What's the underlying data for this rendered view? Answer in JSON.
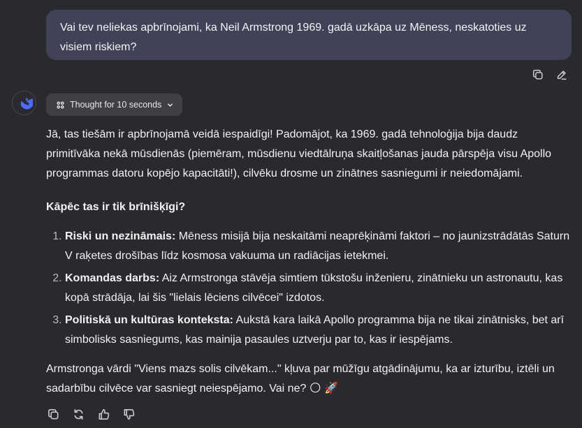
{
  "user_message": "Vai tev neliekas apbrīnojami, ka Neil Armstrong 1969. gadā uzkāpa uz Mēness, neskatoties uz visiem riskiem?",
  "user_actions": {
    "copy_icon": "copy-icon",
    "edit_icon": "edit-icon"
  },
  "assistant": {
    "avatar_icon": "whale-logo-icon",
    "thought_label": "Thought for 10 seconds",
    "intro": "Jā, tas tiešām ir apbrīnojamā veidā iespaidīgi! Padomājot, ka 1969. gadā tehnoloģija bija daudz primitīvāka nekā mūsdienās (piemēram, mūsdienu viedtālruņa skaitļošanas jauda pārspēja visu Apollo programmas datoru kopējo kapacitāti!), cilvēku drosme un zinātnes sasniegumi ir neiedomājami.",
    "heading": "Kāpēc tas ir tik brīnišķīgi?",
    "items": [
      {
        "title": "Riski un nezināmais:",
        "text": " Mēness misijā bija neskaitāmi neaprēķināmi faktori – no jaunizstrādātās Saturn V raķetes drošības līdz kosmosa vakuuma un radiācijas ietekmei."
      },
      {
        "title": "Komandas darbs:",
        "text": " Aiz Armstronga stāvēja simtiem tūkstošu inženieru, zinātnieku un astronautu, kas kopā strādāja, lai šis \"lielais lēciens cilvēcei\" izdotos."
      },
      {
        "title": "Politiskā un kultūras konteksta:",
        "text": " Aukstā kara laikā Apollo programma bija ne tikai zinātnisks, bet arī simbolisks sasniegums, kas mainija pasaules uztverju par to, kas ir iespējams."
      }
    ],
    "outro": "Armstronga vārdi \"Viens mazs solis cilvēkam...\" kļuva par mūžīgu atgādinājumu, ka ar izturību, iztēli un sadarbību cilvēce var sasniegt neiespējamo. Vai ne? 🌕 🚀"
  },
  "bottom_actions": [
    "copy-icon",
    "regenerate-icon",
    "thumbs-up-icon",
    "thumbs-down-icon"
  ],
  "colors": {
    "background": "#292a2d",
    "user_bubble": "#414158",
    "thought_pill": "#3f4044",
    "text": "#f2f2f3",
    "icon": "#c9cacf",
    "logo_blue": "#4d6bfe"
  }
}
